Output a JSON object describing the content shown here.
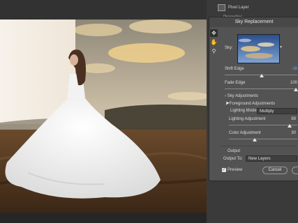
{
  "layers": {
    "row_label": "Pixel Layer",
    "props_label": "Properties"
  },
  "dialog": {
    "title": "Sky Replacement",
    "sky_label": "Sky:",
    "shift_edge": {
      "label": "Shift Edge",
      "value": "-16",
      "level": 0.46
    },
    "fade_edge": {
      "label": "Fade Edge",
      "value": "100",
      "level": 1.0
    },
    "sky_adjustments": "Sky Adjustments",
    "foreground_adjustments": "Foreground Adjustments",
    "lighting_mode": {
      "label": "Lighting Mode:",
      "value": "Multiply"
    },
    "lighting_adjustment": {
      "label": "Lighting Adjustment",
      "value": "89",
      "level": 0.89
    },
    "color_adjustment": {
      "label": "Color Adjustment",
      "value": "30",
      "level": 0.3
    },
    "output": {
      "heading": "Output",
      "label": "Output To:",
      "value": "New Layers"
    },
    "preview": {
      "label": "Preview",
      "checked": true
    },
    "cancel": "Cancel"
  },
  "icons": [
    "move-tool-icon",
    "hand-tool-icon",
    "zoom-tool-icon",
    "layer-icon",
    "dropdown-arrow-icon",
    "cursor-icon",
    "checkmark-icon"
  ],
  "colors": {
    "panel": "#535353",
    "accent_blue": "#6aa6ff",
    "bg": "#2b2b2b"
  }
}
